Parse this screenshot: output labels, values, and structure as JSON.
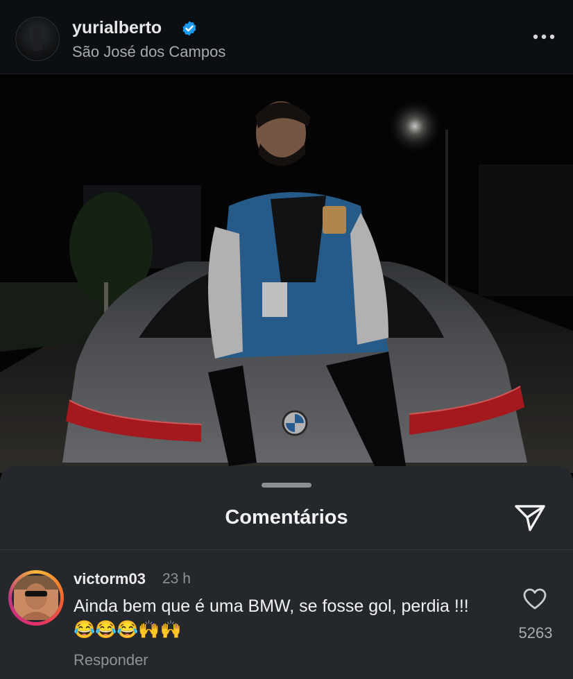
{
  "post": {
    "username": "yurialberto",
    "location": "São José dos Campos"
  },
  "icons": {
    "verified": "verified-badge-icon",
    "more": "more-options-icon",
    "send": "send-icon",
    "like": "heart-icon"
  },
  "colors": {
    "verified": "#1d9bf0",
    "sheet_bg": "#24272b",
    "header_bg": "#0b0f14"
  },
  "comments_sheet": {
    "title": "Comentários"
  },
  "comment": {
    "username": "victorm03",
    "time": "23 h",
    "text": "Ainda bem que é uma BMW, se fosse gol, perdia !!! 😂😂😂🙌🙌",
    "reply_label": "Responder",
    "likes": "5263"
  }
}
